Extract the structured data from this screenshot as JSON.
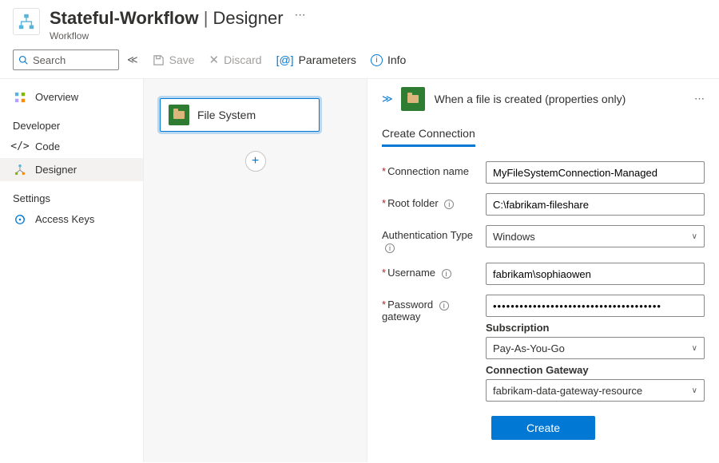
{
  "header": {
    "title": "Stateful-Workflow",
    "section": "Designer",
    "subtitle": "Workflow"
  },
  "toolbar": {
    "search_placeholder": "Search",
    "save": "Save",
    "discard": "Discard",
    "parameters": "Parameters",
    "info": "Info"
  },
  "sidebar": {
    "overview": "Overview",
    "dev_heading": "Developer",
    "code": "Code",
    "designer": "Designer",
    "settings_heading": "Settings",
    "access_keys": "Access Keys"
  },
  "canvas": {
    "node_label": "File System"
  },
  "panel": {
    "trigger_title": "When a file is created (properties only)",
    "tab": "Create Connection",
    "labels": {
      "conn_name": "Connection name",
      "root_folder": "Root folder",
      "auth_type": "Authentication Type",
      "username": "Username",
      "password": "Password",
      "gateway": "gateway",
      "subscription": "Subscription",
      "conn_gateway": "Connection Gateway"
    },
    "values": {
      "conn_name": "MyFileSystemConnection-Managed",
      "root_folder": "C:\\fabrikam-fileshare",
      "auth_type": "Windows",
      "username": "fabrikam\\sophiaowen",
      "password": "••••••••••••••••••••••••••••••••••••••",
      "subscription": "Pay-As-You-Go",
      "conn_gateway": "fabrikam-data-gateway-resource"
    },
    "create_btn": "Create"
  }
}
